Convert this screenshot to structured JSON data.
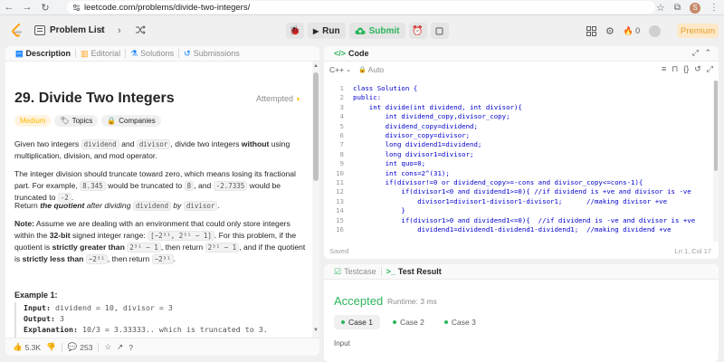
{
  "browser": {
    "url": "leetcode.com/problems/divide-two-integers/",
    "profile_initial": "S"
  },
  "header": {
    "problem_list_label": "Problem List",
    "run_label": "Run",
    "submit_label": "Submit",
    "streak_count": "0",
    "premium_label": "Premium"
  },
  "left_tabs": [
    "Description",
    "Editorial",
    "Solutions",
    "Submissions"
  ],
  "problem": {
    "title": "29. Divide Two Integers",
    "status": "Attempted",
    "difficulty": "Medium",
    "topics_label": "Topics",
    "companies_label": "Companies"
  },
  "description": {
    "p1": {
      "a": "Given two integers ",
      "code1": "dividend",
      "b": " and ",
      "code2": "divisor",
      "c": ", divide two integers ",
      "bold": "without",
      "d": " using multiplication, division, and mod operator."
    },
    "p2": {
      "a": "The integer division should truncate toward zero, which means losing its fractional part. For example, ",
      "code1": "8.345",
      "b": " would be truncated to ",
      "code2": "8",
      "c": ", and ",
      "code3": "-2.7335",
      "d": " would be truncated to ",
      "code4": "-2",
      "e": "."
    },
    "p3": {
      "a": "Return ",
      "bold_italic": "the quotient",
      "b": " after dividing ",
      "code1": "dividend",
      "c": " by ",
      "code2": "divisor",
      "d": "."
    },
    "p4": {
      "note_label": "Note:",
      "a": " Assume we are dealing with an environment that could only store integers within the ",
      "bold1": "32-bit",
      "b": " signed integer range: ",
      "code1": "[−2³¹, 2³¹ − 1]",
      "c": ". For this problem, if the quotient is ",
      "bold2": "strictly greater than",
      "d": " ",
      "code2": "2³¹ − 1",
      "e": ", then return ",
      "code3": "2³¹ − 1",
      "f": ", and if the quotient is ",
      "bold3": "strictly less than",
      "g": " ",
      "code4": "−2³¹",
      "h": ", then return ",
      "code5": "−2³¹",
      "i": "."
    },
    "example_heading": "Example 1:",
    "example": {
      "input_label": "Input:",
      "input_value": " dividend = 10, divisor = 3",
      "output_label": "Output:",
      "output_value": " 3",
      "explanation_label": "Explanation:",
      "explanation_value": " 10/3 = 3.33333.. which is truncated to 3."
    }
  },
  "bottom_bar": {
    "likes": "5.3K",
    "comments": "253"
  },
  "editor": {
    "tab_label": "Code",
    "language": "C++",
    "auto_label": "Auto",
    "status_left": "Saved",
    "status_right": "Ln 1, Col 17",
    "lines": [
      {
        "n": "1",
        "text": "class Solution {"
      },
      {
        "n": "2",
        "text": "public:"
      },
      {
        "n": "3",
        "text": "    int divide(int dividend, int divisor){"
      },
      {
        "n": "4",
        "text": "        int dividend_copy,divisor_copy;"
      },
      {
        "n": "5",
        "text": "        dividend_copy=dividend;"
      },
      {
        "n": "6",
        "text": "        divisor_copy=divisor;"
      },
      {
        "n": "7",
        "text": "        long dividend1=dividend;"
      },
      {
        "n": "8",
        "text": "        long divisor1=divisor;"
      },
      {
        "n": "9",
        "text": "        int quo=0;"
      },
      {
        "n": "10",
        "text": "        int cons=2^(31);"
      },
      {
        "n": "11",
        "text": "        if(divisor!=0 or dividend_copy>=-cons and divisor_copy<=cons-1){"
      },
      {
        "n": "12",
        "text": "            if(divisor1<0 and dividend1>=0){ //if dividend is +ve and divisor is -ve"
      },
      {
        "n": "13",
        "text": "                divisor1=divisor1-divisor1-divisor1;      //making divisor +ve"
      },
      {
        "n": "14",
        "text": "            }"
      },
      {
        "n": "15",
        "text": "            if(divisor1>0 and dividend1<=0){  //if dividend is -ve and divisor is +ve"
      },
      {
        "n": "16",
        "text": "                dividend1=dividend1-dividend1-dividend1;  //making dividend +ve"
      }
    ]
  },
  "result": {
    "tab_testcase": "Testcase",
    "tab_result": "Test Result",
    "verdict": "Accepted",
    "runtime": "Runtime: 3 ms",
    "cases": [
      "Case 1",
      "Case 2",
      "Case 3"
    ],
    "input_label": "Input"
  },
  "colors": {
    "accent_green": "#2db55d",
    "medium_yellow": "#ffb800",
    "premium_orange": "#e6a02a",
    "code_blue": "#0000cc"
  }
}
